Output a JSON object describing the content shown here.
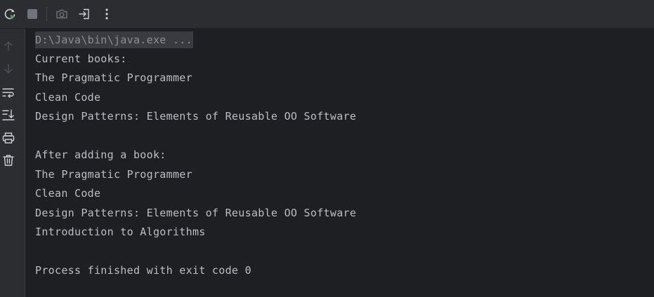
{
  "toolbar": {
    "icons": [
      "rerun-icon",
      "stop-icon",
      "camera-icon",
      "exit-icon",
      "more-vertical-icon"
    ],
    "colors": {
      "rerun_accent": "#57965c",
      "disabled": "#6f737a"
    }
  },
  "gutter": {
    "icons": [
      "arrow-up-icon",
      "arrow-down-icon",
      "soft-wrap-icon",
      "scroll-to-end-icon",
      "print-icon",
      "trash-icon"
    ]
  },
  "console": {
    "command": "D:\\Java\\bin\\java.exe ...",
    "lines": {
      "l1": "Current books:",
      "l2": "The Pragmatic Programmer",
      "l3": "Clean Code",
      "l4": "Design Patterns: Elements of Reusable OO Software",
      "l5": "After adding a book:",
      "l6": "The Pragmatic Programmer",
      "l7": "Clean Code",
      "l8": "Design Patterns: Elements of Reusable OO Software",
      "l9": "Introduction to Algorithms",
      "l10": "Process finished with exit code 0"
    },
    "colors": {
      "text": "#bcbec4",
      "background": "#1e1f22",
      "command_bg": "#393b40"
    }
  }
}
